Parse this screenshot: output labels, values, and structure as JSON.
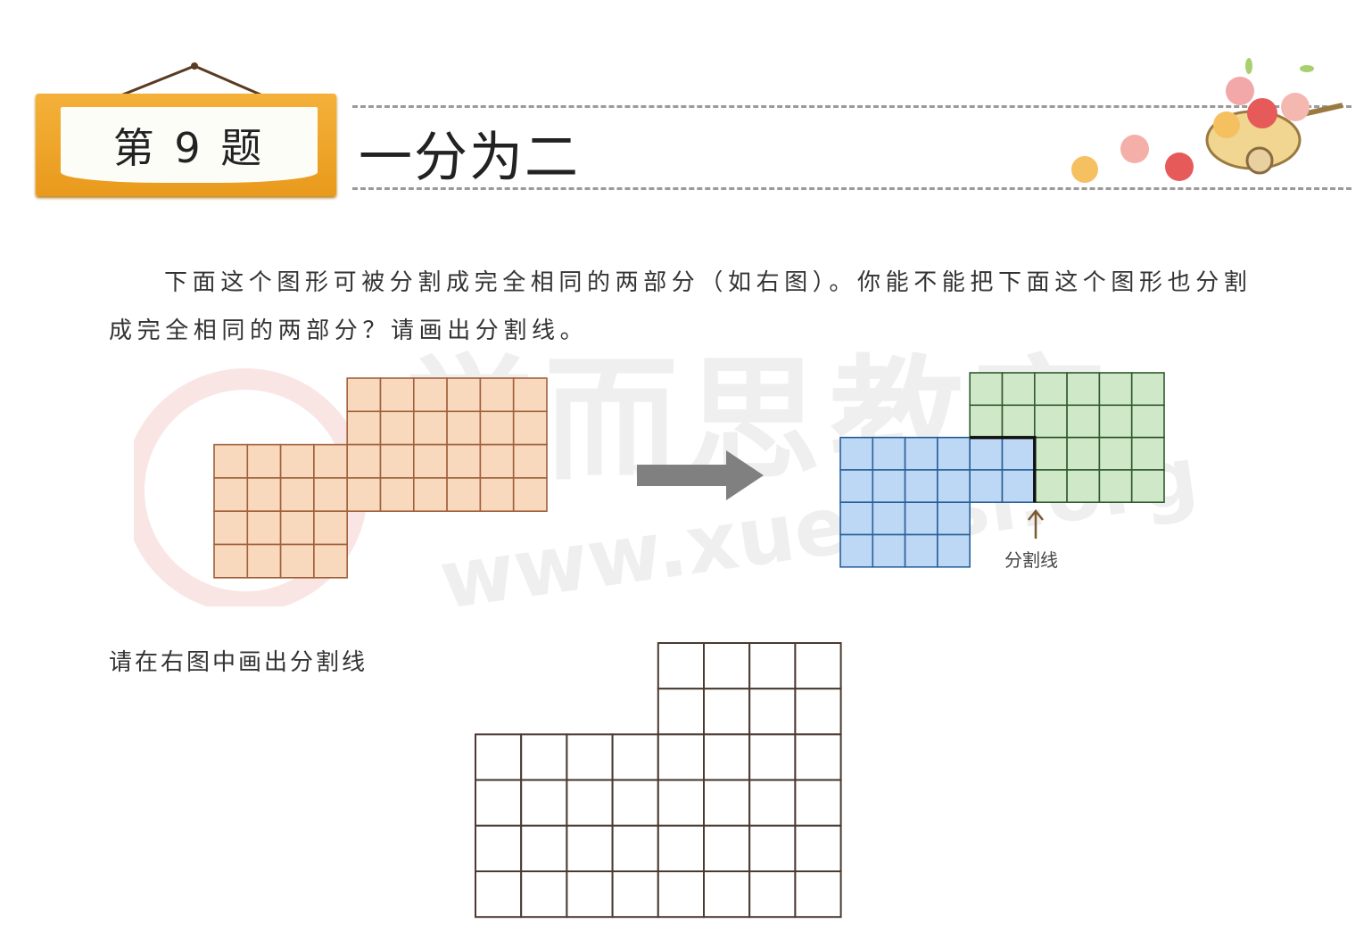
{
  "header": {
    "badge": "第 9 题",
    "title": "一分为二"
  },
  "instruction": "下面这个图形可被分割成完全相同的两部分（如右图）。你能不能把下面这个图形也分割成完全相同的两部分？请画出分割线。",
  "example": {
    "division_label": "分割线",
    "colors": {
      "original_fill": "#f8d9bd",
      "original_stroke": "#a0603a",
      "part_a_fill": "#bcd8f4",
      "part_a_stroke": "#2a5f9a",
      "part_b_fill": "#cfe8c8",
      "part_b_stroke": "#2f5a2f",
      "arrow": "#808080"
    }
  },
  "exercise": {
    "prompt": "请在右图中画出分割线",
    "stroke": "#4a3a30"
  },
  "watermark": {
    "text": "学而思教育",
    "url": "www.xueersi.org"
  }
}
